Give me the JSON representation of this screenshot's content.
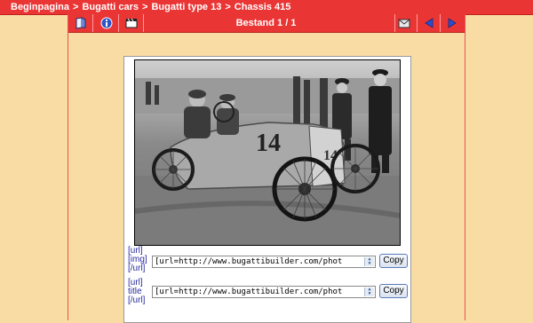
{
  "breadcrumb": [
    "Beginpagina",
    "Bugatti cars",
    "Bugatti type 13",
    "Chassis 415"
  ],
  "breadcrumb_separator": ">",
  "toolbar": {
    "title": "Bestand 1 / 1",
    "icons": [
      "thumbnails-icon",
      "info-icon",
      "slideshow-icon",
      "email-icon",
      "previous-icon",
      "next-icon"
    ]
  },
  "photo": {
    "number_text": "14"
  },
  "share": {
    "img": {
      "label_lines": [
        "[url]",
        "[img]",
        "[/url]"
      ],
      "value": "[url=http://www.bugattibuilder.com/phot",
      "button": "Copy"
    },
    "title": {
      "label_lines": [
        "[url]",
        "title",
        "[/url]"
      ],
      "value": "[url=http://www.bugattibuilder.com/phot",
      "button": "Copy"
    }
  },
  "colors": {
    "background": "#f9dca4",
    "bar": "#ea3535",
    "link": "#2a2aa0"
  }
}
